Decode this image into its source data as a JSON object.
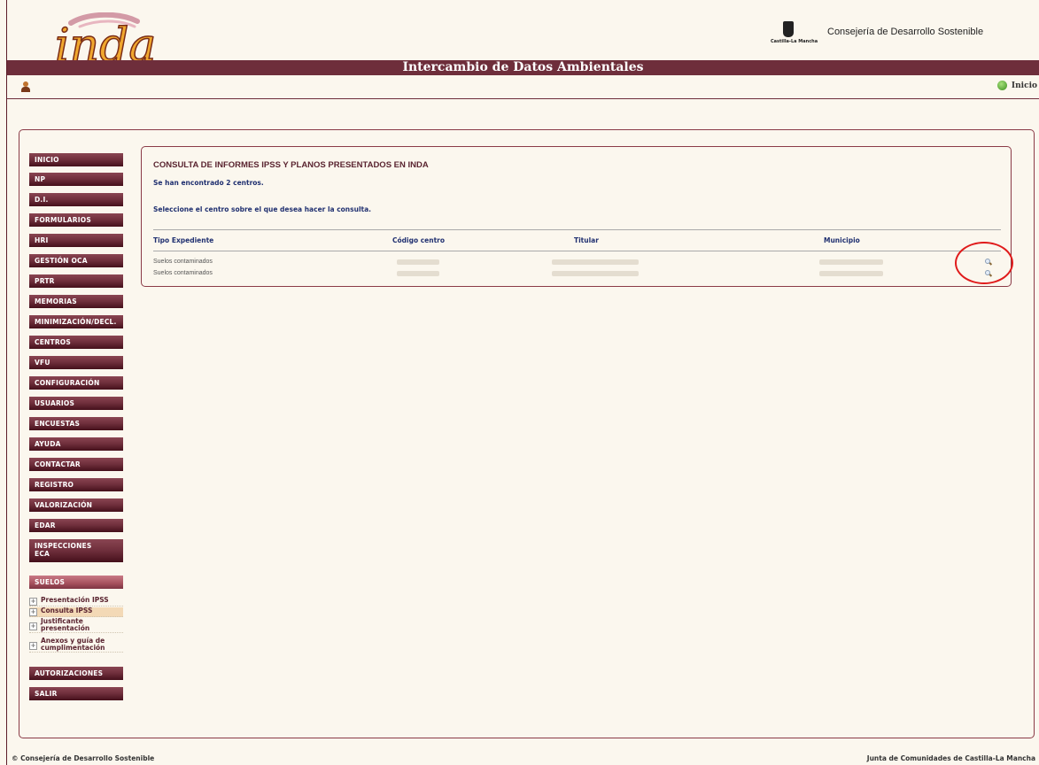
{
  "header": {
    "logo_text": "inda",
    "crest_label": "Castilla-La Mancha",
    "consejeria": "Consejería de Desarrollo Sostenible",
    "banner_title": "Intercambio de Datos Ambientales",
    "inicio_link": "Inicio"
  },
  "sidebar": {
    "items": [
      {
        "label": "INICIO"
      },
      {
        "label": "NP"
      },
      {
        "label": "D.I."
      },
      {
        "label": "FORMULARIOS"
      },
      {
        "label": "HRI"
      },
      {
        "label": "GESTIÓN OCA"
      },
      {
        "label": "PRTR"
      },
      {
        "label": "MEMORIAS"
      },
      {
        "label": "MINIMIZACIÓN/DECL."
      },
      {
        "label": "CENTROS"
      },
      {
        "label": "VFU"
      },
      {
        "label": "CONFIGURACIÓN"
      },
      {
        "label": "USUARIOS"
      },
      {
        "label": "ENCUESTAS"
      },
      {
        "label": "AYUDA"
      },
      {
        "label": "CONTACTAR"
      },
      {
        "label": "REGISTRO"
      },
      {
        "label": "VALORIZACIÓN"
      },
      {
        "label": "EDAR"
      },
      {
        "label": "INSPECCIONES ECA"
      },
      {
        "label": "SUELOS"
      },
      {
        "label": "AUTORIZACIONES"
      },
      {
        "label": "SALIR"
      }
    ],
    "submenu": [
      {
        "label": "Presentación IPSS"
      },
      {
        "label": "Consulta IPSS"
      },
      {
        "label": "Justificante presentación"
      },
      {
        "label": "Anexos y guía de cumplimentación"
      }
    ]
  },
  "main": {
    "title": "CONSULTA DE INFORMES IPSS Y PLANOS PRESENTADOS EN INDA",
    "found_text": "Se han encontrado 2 centros.",
    "instruction": "Seleccione el centro sobre el que desea hacer la consulta.",
    "columns": [
      "Tipo Expediente",
      "Código centro",
      "Titular",
      "Municipio"
    ],
    "rows": [
      {
        "tipo": "Suelos contaminados"
      },
      {
        "tipo": "Suelos contaminados"
      }
    ],
    "action_icon": "magnifier-icon"
  },
  "footer": {
    "left": "© Consejería de Desarrollo Sostenible",
    "right": "Junta de Comunidades de Castilla-La Mancha"
  },
  "colors": {
    "accent": "#6e2e3b",
    "background": "#fbf7ee",
    "text_blue": "#203070",
    "highlight_circle": "#e01b1b"
  }
}
